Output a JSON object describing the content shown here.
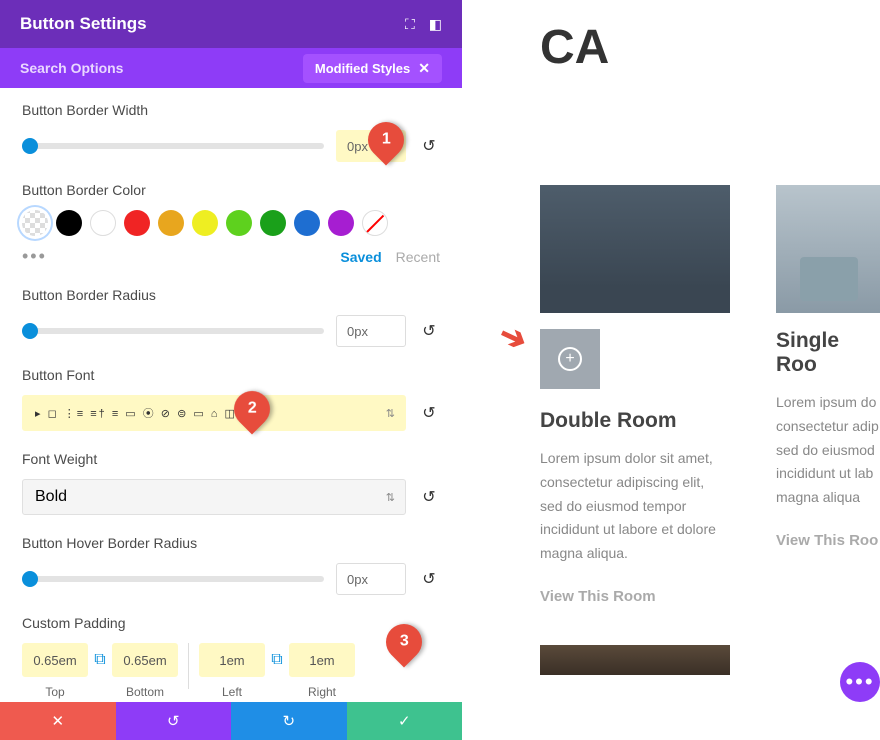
{
  "header": {
    "title": "Button Settings"
  },
  "subheader": {
    "label": "Search Options",
    "badge": "Modified Styles"
  },
  "settings": {
    "border_width": {
      "label": "Button Border Width",
      "value": "0px"
    },
    "border_color": {
      "label": "Button Border Color",
      "saved": "Saved",
      "recent": "Recent"
    },
    "border_radius": {
      "label": "Button Border Radius",
      "value": "0px"
    },
    "font": {
      "label": "Button Font",
      "icons_repr": "▸ ◻ ⋮≡ ≡† ≡ ▭ ⦿ ⊘ ⊜ ▭ ⌂ ◫ ⚠"
    },
    "font_weight": {
      "label": "Font Weight",
      "value": "Bold"
    },
    "hover_radius": {
      "label": "Button Hover Border Radius",
      "value": "0px"
    },
    "padding": {
      "label": "Custom Padding",
      "top": {
        "value": "0.65em",
        "label": "Top"
      },
      "bottom": {
        "value": "0.65em",
        "label": "Bottom"
      },
      "left": {
        "value": "1em",
        "label": "Left"
      },
      "right": {
        "value": "1em",
        "label": "Right"
      }
    }
  },
  "colors": {
    "swatches": [
      "transparent",
      "#000000",
      "#ffffff",
      "#f02424",
      "#e8a61e",
      "#e8e81e",
      "#5ed11e",
      "#1aa01a",
      "#1e6ed1",
      "#a61ed1",
      "strike"
    ]
  },
  "preview": {
    "heading": "CA",
    "card1": {
      "title": "Double Room",
      "text": "Lorem ipsum dolor sit amet, consectetur adipiscing elit, sed do eiusmod tempor incididunt ut labore et dolore magna aliqua.",
      "link": "View This Room"
    },
    "card2": {
      "title": "Single Roo",
      "text": "Lorem ipsum do consectetur adip sed do eiusmod incididunt ut lab magna aliqua",
      "link": "View This Roo"
    }
  },
  "markers": {
    "m1": "1",
    "m2": "2",
    "m3": "3"
  }
}
